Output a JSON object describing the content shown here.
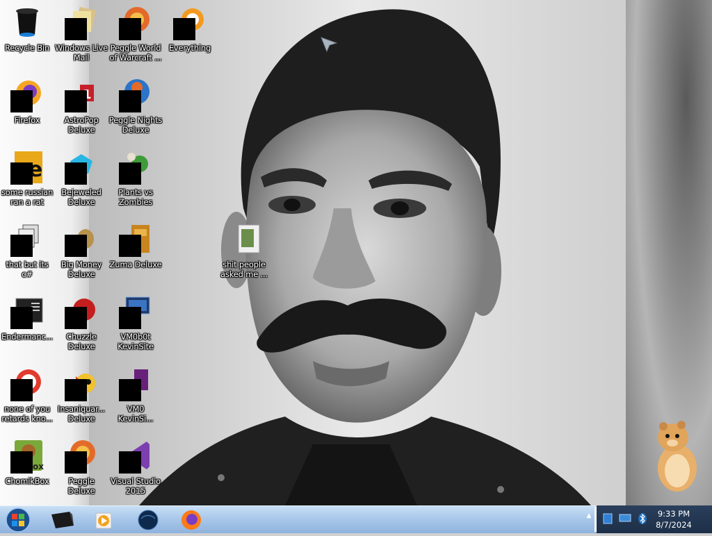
{
  "desktop": {
    "icons": [
      {
        "name": "recycle-bin",
        "label": "Recycle Bin"
      },
      {
        "name": "windows-live-mail",
        "label": "Windows Live\nMail"
      },
      {
        "name": "peggle-world-of-warcraft",
        "label": "Peggle World\nof Warcraft ..."
      },
      {
        "name": "everything",
        "label": "Everything"
      },
      {
        "name": "firefox",
        "label": "Firefox"
      },
      {
        "name": "astropop-deluxe",
        "label": "AstroPop\nDeluxe"
      },
      {
        "name": "peggle-nights-deluxe",
        "label": "Peggle Nights\nDeluxe"
      },
      {
        "name": "some-russian-ran-a-rat",
        "label": "some russian\nran a rat"
      },
      {
        "name": "bejeweled-deluxe",
        "label": "Bejeweled\nDeluxe"
      },
      {
        "name": "plants-vs-zombies",
        "label": "Plants vs\nZombies"
      },
      {
        "name": "that-but-its-csharp",
        "label": "that but its c#"
      },
      {
        "name": "big-money-deluxe",
        "label": "Big Money\nDeluxe"
      },
      {
        "name": "zuma-deluxe",
        "label": "Zuma Deluxe"
      },
      {
        "name": "endermanc",
        "label": "Endermanc..."
      },
      {
        "name": "chuzzle-deluxe",
        "label": "Chuzzle\nDeluxe"
      },
      {
        "name": "vm0b0t-kevinsite",
        "label": "VM0b0t\nKevinSite"
      },
      {
        "name": "none-of-you-retards",
        "label": "none of you\nretards kno..."
      },
      {
        "name": "insaniquarium-deluxe",
        "label": "Insaniquar...\nDeluxe"
      },
      {
        "name": "vm0-kevinsite",
        "label": "VM0\nKevinSi..."
      },
      {
        "name": "chomikbox",
        "label": "ChomikBox"
      },
      {
        "name": "peggle-deluxe",
        "label": "Peggle Deluxe"
      },
      {
        "name": "visual-studio-2015",
        "label": "Visual Studio\n2015"
      },
      {
        "name": "shit-people-asked-me",
        "label": "shit people\nasked me ..."
      }
    ]
  },
  "taskbar": {
    "pinned": [
      "app-icon",
      "media-player-icon",
      "globe-icon",
      "firefox-icon"
    ],
    "tray_icons": [
      "network-icon",
      "display-icon",
      "bluetooth-icon"
    ],
    "time": "9:33 PM",
    "date": "8/7/2024"
  }
}
